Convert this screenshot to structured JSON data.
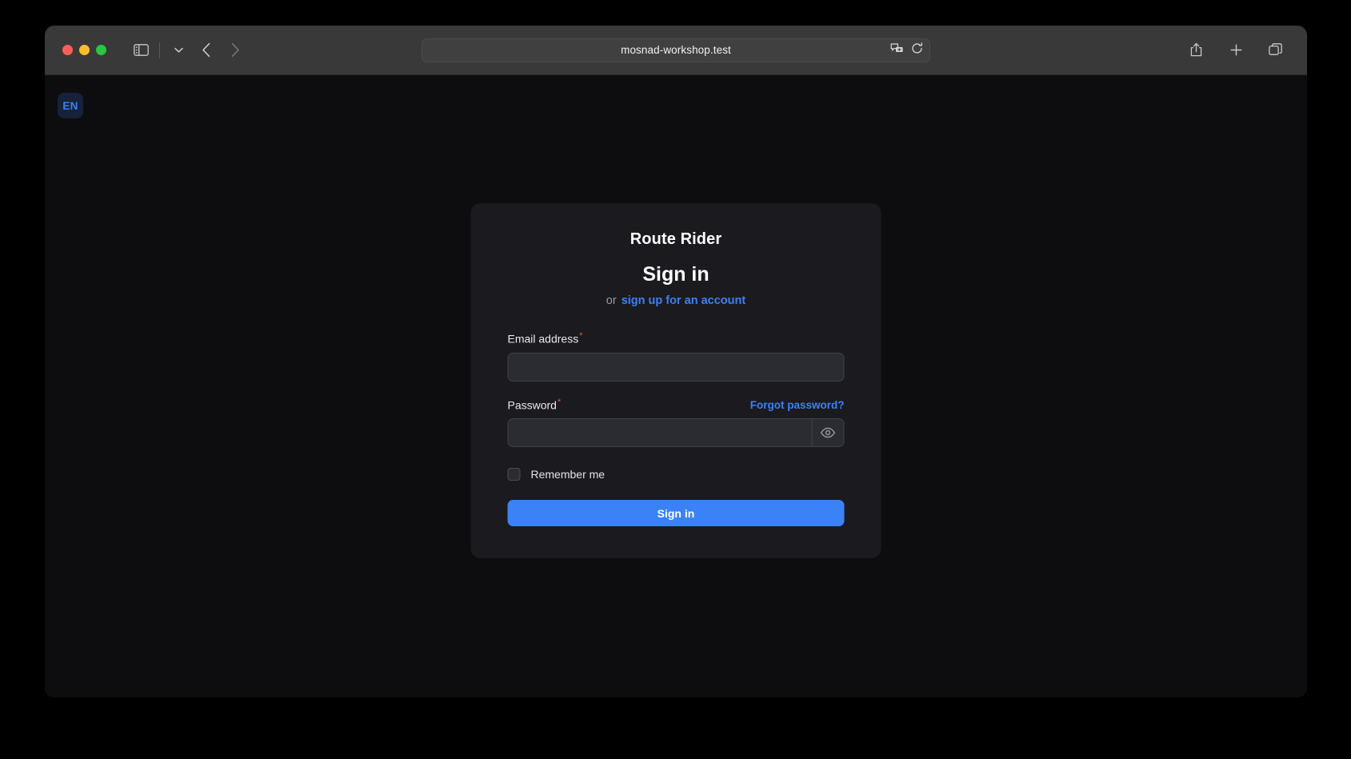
{
  "browser": {
    "url": "mosnad-workshop.test",
    "traffic_lights": [
      "close",
      "minimize",
      "maximize"
    ],
    "toolbar_icons": {
      "sidebar": "sidebar-icon",
      "chevron": "chevron-down-icon",
      "back": "back-arrow-icon",
      "forward": "forward-arrow-icon",
      "translate": "translate-icon",
      "reload": "reload-icon",
      "share": "share-icon",
      "new_tab": "plus-icon",
      "tab_overview": "tab-overview-icon"
    }
  },
  "page": {
    "language_badge": "EN",
    "background_color": "#0d0d0f"
  },
  "card": {
    "brand": "Route Rider",
    "title": "Sign in",
    "subline_prefix": "or",
    "signup_link": "sign up for an account",
    "email": {
      "label": "Email address",
      "required_marker": "*",
      "value": "",
      "placeholder": ""
    },
    "password": {
      "label": "Password",
      "required_marker": "*",
      "value": "",
      "placeholder": "",
      "forgot_link": "Forgot password?",
      "toggle_icon": "eye-icon"
    },
    "remember": {
      "label": "Remember me",
      "checked": false
    },
    "submit_label": "Sign in",
    "accent_color": "#3b82f6",
    "required_color": "#e05a5a",
    "card_color": "#1a1a1f"
  }
}
